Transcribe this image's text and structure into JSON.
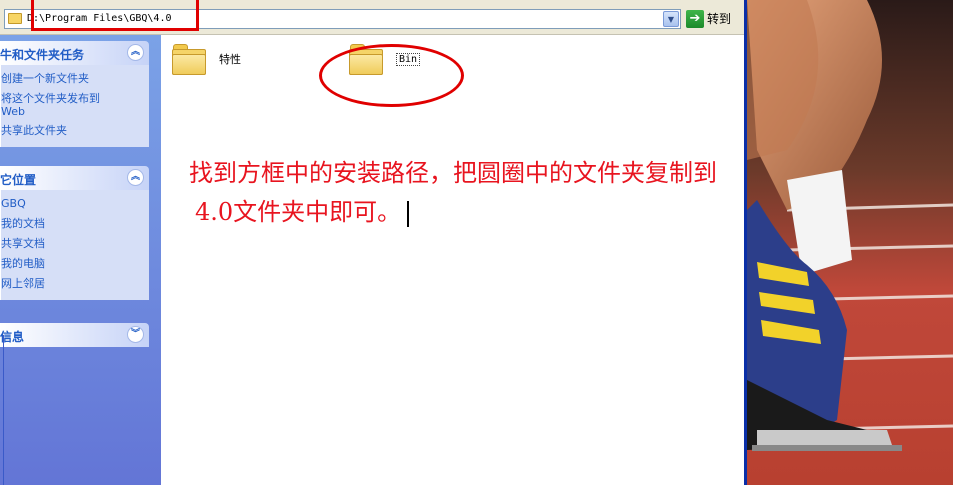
{
  "address_bar": {
    "path": "D:\\Program Files\\GBQ\\4.0",
    "go_label": "转到"
  },
  "task_pane": {
    "tasks": {
      "title": "文件和文件夹任务",
      "visible_title": "牛和文件夹任务",
      "items": [
        "创建一个新文件夹",
        "将这个文件夹发布到\nWeb",
        "共享此文件夹"
      ]
    },
    "places": {
      "title": "其它位置",
      "visible_title": "它位置",
      "items": [
        "GBQ",
        "我的文档",
        "共享文档",
        "我的电脑",
        "网上邻居"
      ]
    },
    "details": {
      "title": "详细信息",
      "visible_title": "信息"
    }
  },
  "folders": [
    {
      "name": "特性"
    },
    {
      "name": "Bin"
    }
  ],
  "annotation": {
    "line1": "找到方框中的安装路径，把圆圈中的文件夹复制到",
    "line2": "4.0文件夹中即可。"
  },
  "colors": {
    "annotation_red": "#e8141f",
    "link_blue": "#215dc6",
    "pane_blue": "#6375d6"
  }
}
